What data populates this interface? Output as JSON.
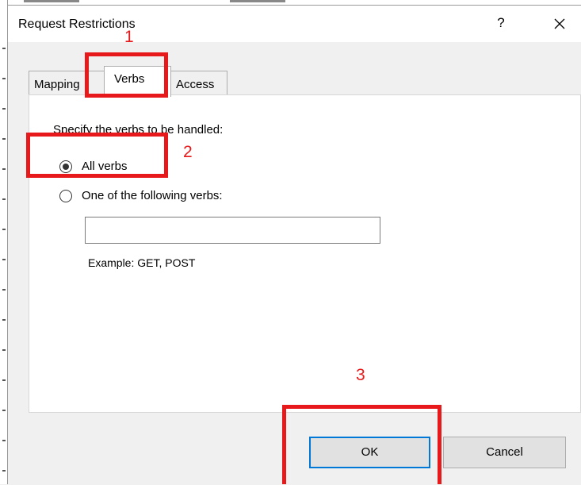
{
  "dialog": {
    "title": "Request Restrictions",
    "help_label": "?",
    "close_label": "✕"
  },
  "tabs": [
    {
      "label": "Mapping",
      "selected": false
    },
    {
      "label": "Verbs",
      "selected": true
    },
    {
      "label": "Access",
      "selected": false
    }
  ],
  "verbs_panel": {
    "heading": "Specify the verbs to be handled:",
    "option_all_label": "All verbs",
    "option_all_checked": true,
    "option_one_label": "One of the following verbs:",
    "option_one_checked": false,
    "verbs_input_value": "",
    "example_text": "Example: GET, POST"
  },
  "buttons": {
    "ok_label": "OK",
    "cancel_label": "Cancel"
  },
  "annotations": {
    "step1": "1",
    "step2": "2",
    "step3": "3",
    "color": "#e8191a"
  },
  "colors": {
    "focus_border": "#0078d7",
    "dialog_bg": "#f0f0f0",
    "panel_bg": "#ffffff"
  }
}
